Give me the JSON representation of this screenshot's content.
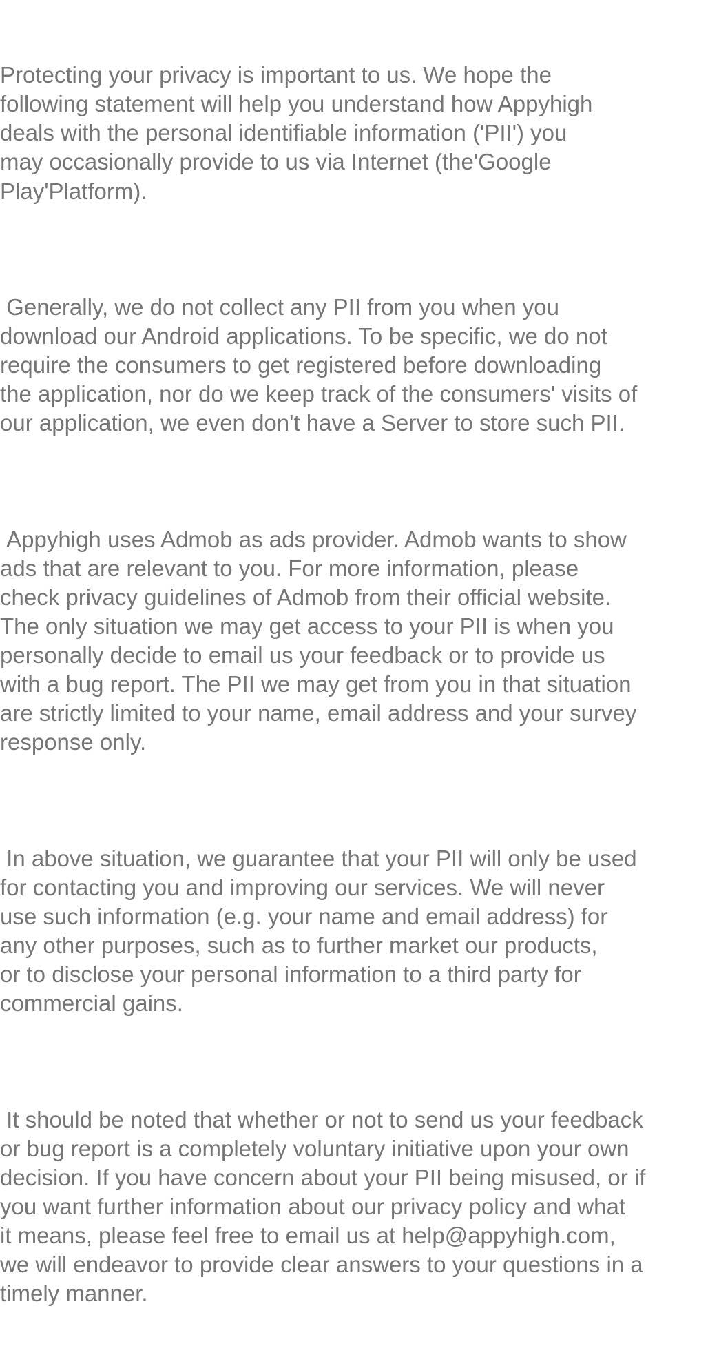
{
  "policy": {
    "paragraphs": [
      {
        "lines": [
          "Protecting your privacy is important to us. We hope the",
          "following statement will help you understand how Appyhigh",
          "deals with the personal identifiable information ('PII') you",
          "may occasionally provide to us via Internet (the'Google",
          "Play'Platform)."
        ]
      },
      {
        "lines": [
          " Generally, we do not collect any PII from you when you",
          "download our Android applications. To be specific, we do not",
          "require the consumers to get registered before downloading",
          "the application, nor do we keep track of the consumers' visits of",
          "our application, we even don't have a Server to store such PII."
        ]
      },
      {
        "lines": [
          " Appyhigh uses Admob as ads provider. Admob wants to show",
          "ads that are relevant to you. For more information, please",
          "check privacy guidelines of Admob from their official website.",
          "The only situation we may get access to your PII is when you",
          "personally decide to email us your feedback or to provide us",
          "with a bug report. The PII we may get from you in that situation",
          "are strictly limited to your name, email address and your survey",
          "response only."
        ]
      },
      {
        "lines": [
          " In above situation, we guarantee that your PII will only be used",
          "for contacting you and improving our services. We will never",
          "use such information (e.g. your name and email address) for",
          "any other purposes, such as to further market our products,",
          "or to disclose your personal information to a third party for",
          "commercial gains."
        ]
      },
      {
        "lines": [
          " It should be noted that whether or not to send us your feedback",
          "or bug report is a completely voluntary initiative upon your own",
          "decision. If you have concern about your PII being misused, or if",
          "you want further information about our privacy policy and what",
          "it means, please feel free to email us at help@appyhigh.com,",
          "we will endeavor to provide clear answers to your questions in a",
          "timely manner."
        ]
      }
    ]
  },
  "colors": {
    "text": "#767676",
    "background": "#ffffff"
  }
}
